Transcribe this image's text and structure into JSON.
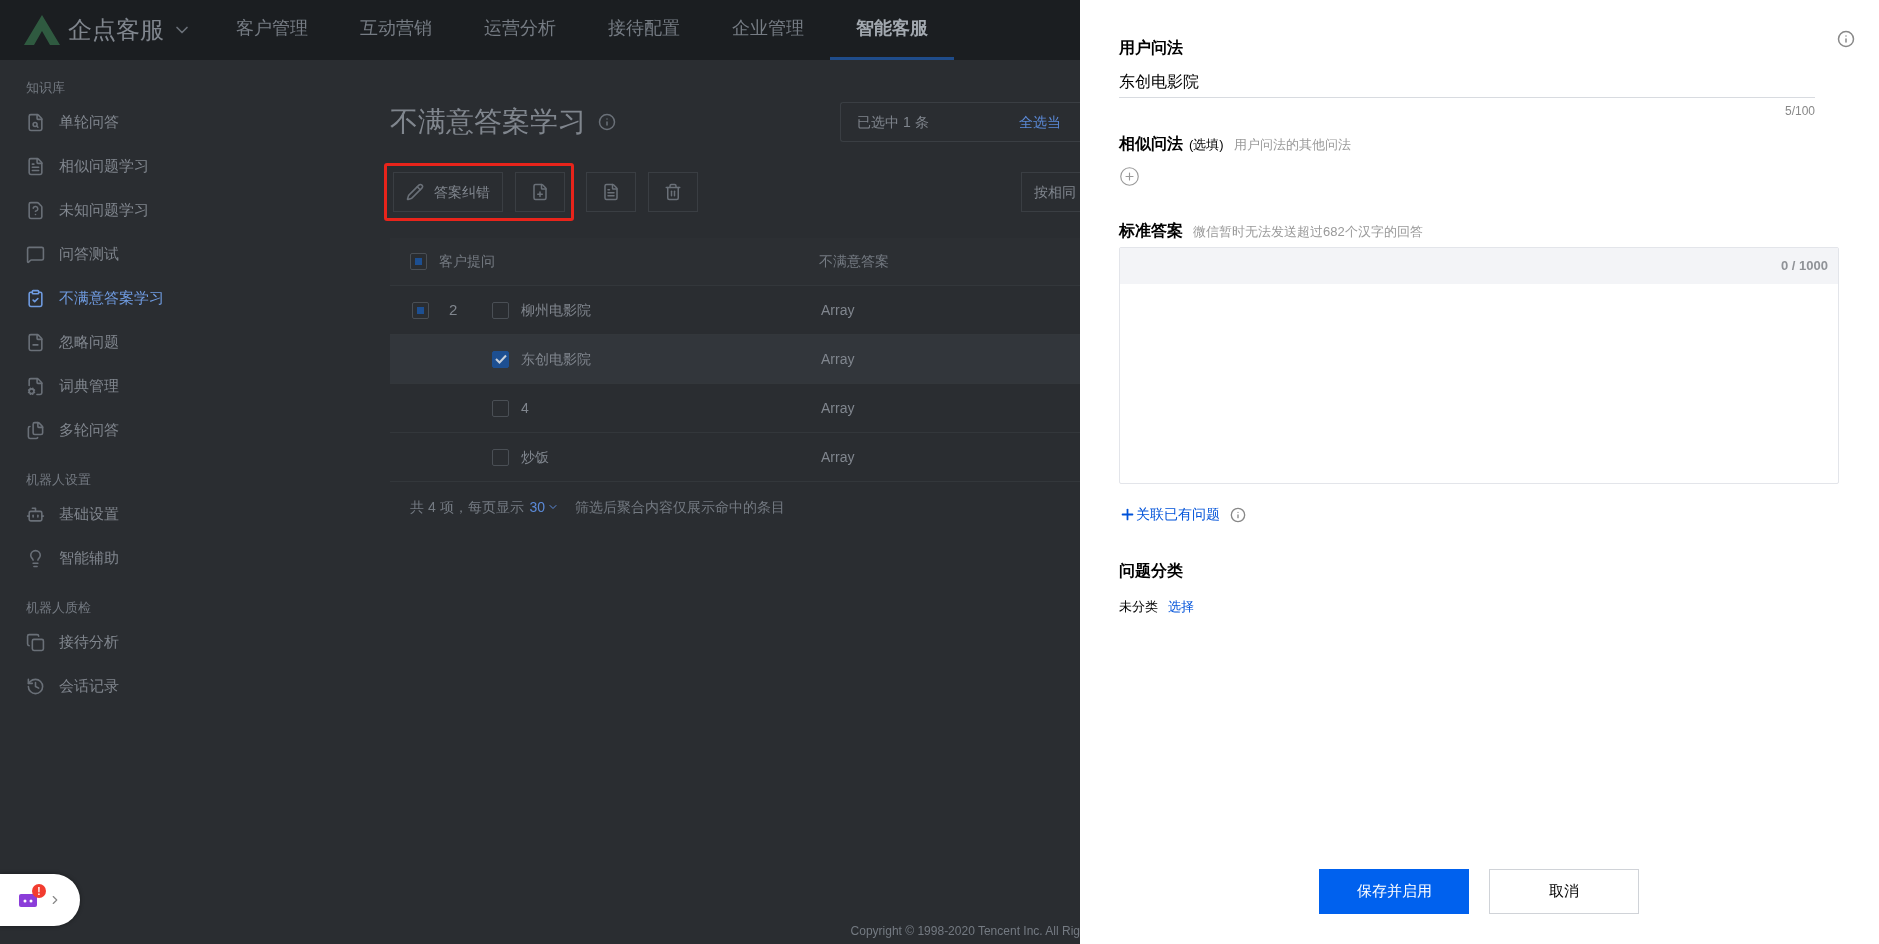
{
  "nav": {
    "logo_text": "企点客服",
    "items": [
      {
        "label": "客户管理",
        "selected": false
      },
      {
        "label": "互动营销",
        "selected": false
      },
      {
        "label": "运营分析",
        "selected": false
      },
      {
        "label": "接待配置",
        "selected": false
      },
      {
        "label": "企业管理",
        "selected": false
      },
      {
        "label": "智能客服",
        "selected": true
      }
    ]
  },
  "sidebar": {
    "sections": [
      {
        "title": "知识库",
        "items": [
          {
            "label": "单轮问答",
            "selected": false
          },
          {
            "label": "相似问题学习",
            "selected": false
          },
          {
            "label": "未知问题学习",
            "selected": false
          },
          {
            "label": "问答测试",
            "selected": false
          },
          {
            "label": "不满意答案学习",
            "selected": true
          },
          {
            "label": "忽略问题",
            "selected": false
          },
          {
            "label": "词典管理",
            "selected": false
          },
          {
            "label": "多轮问答",
            "selected": false
          }
        ]
      },
      {
        "title": "机器人设置",
        "items": [
          {
            "label": "基础设置",
            "selected": false
          },
          {
            "label": "智能辅助",
            "selected": false
          }
        ]
      },
      {
        "title": "机器人质检",
        "items": [
          {
            "label": "接待分析",
            "selected": false
          },
          {
            "label": "会话记录",
            "selected": false
          }
        ]
      }
    ]
  },
  "main": {
    "title": "不满意答案学习",
    "selection_text": "已选中 1 条",
    "select_all_link": "全选当",
    "toolbar": {
      "edit_button": "答案纠错",
      "group_button": "按相同"
    },
    "table": {
      "columns": [
        "客户提问",
        "不满意答案"
      ],
      "header_indeterminate": true,
      "rows": [
        {
          "group_count": "2",
          "group_indeterminate": true,
          "question": "柳州电影院",
          "answer": "Array",
          "checked": false
        },
        {
          "question": "东创电影院",
          "answer": "Array",
          "checked": true
        },
        {
          "question": "4",
          "answer": "Array",
          "checked": false
        },
        {
          "question": "炒饭",
          "answer": "Array",
          "checked": false
        }
      ]
    },
    "footer": {
      "total": "共 4 项，每页显示",
      "page_size": "30",
      "note": "筛选后聚合内容仅展示命中的条目"
    },
    "copyright": "Copyright © 1998-2020 Tencent Inc. All Rig"
  },
  "drawer": {
    "user_question": {
      "label": "用户问法",
      "value": "东创电影院",
      "counter": "5/100"
    },
    "similar": {
      "label": "相似问法",
      "optional": "(选填)",
      "hint": "用户问法的其他问法"
    },
    "answer": {
      "label": "标准答案",
      "hint": "微信暂时无法发送超过682个汉字的回答",
      "counter": "0 / 1000"
    },
    "link_related": "关联已有问题",
    "category": {
      "label": "问题分类",
      "value": "未分类",
      "action": "选择"
    },
    "buttons": {
      "primary": "保存并启用",
      "secondary": "取消"
    }
  },
  "widget": {
    "badge": "!"
  }
}
